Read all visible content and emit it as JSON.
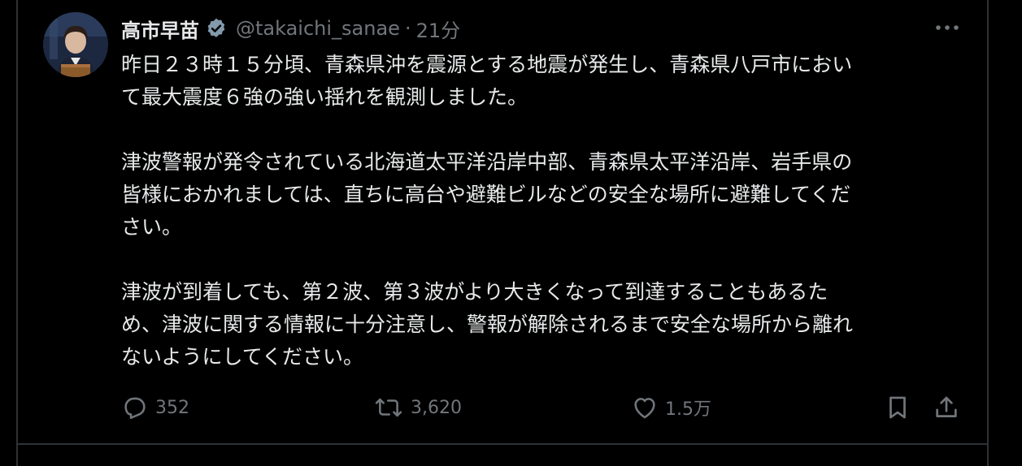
{
  "tweet": {
    "author_name": "高市早苗",
    "handle": "@takaichi_sanae",
    "separator": "·",
    "time": "21分",
    "paragraphs": [
      [
        "昨日２３時１５分頃、青森県沖を震源とする地震が発生し、青森県八戸市におい",
        "て最大震度６強の強い揺れを観測しました。"
      ],
      [
        "津波警報が発令されている北海道太平洋沿岸中部、青森県太平洋沿岸、岩手県の",
        "皆様におかれましては、直ちに高台や避難ビルなどの安全な場所に避難してくだ",
        "さい。"
      ],
      [
        "津波が到着しても、第２波、第３波がより大きくなって到達することもあるた",
        "め、津波に関する情報に十分注意し、警報が解除されるまで安全な場所から離れ",
        "ないようにしてください。"
      ]
    ],
    "actions": {
      "reply_count": "352",
      "repost_count": "3,620",
      "like_count": "1.5万"
    }
  },
  "icons": {
    "verified": "verified-badge-icon",
    "more": "more-options-icon",
    "reply": "reply-icon",
    "repost": "repost-icon",
    "like": "heart-icon",
    "bookmark": "bookmark-icon",
    "share": "share-icon"
  },
  "colors": {
    "background": "#000000",
    "text_primary": "#e7e9ea",
    "text_secondary": "#71767b",
    "border": "#2f3336",
    "verified_badge": "#829aab"
  }
}
